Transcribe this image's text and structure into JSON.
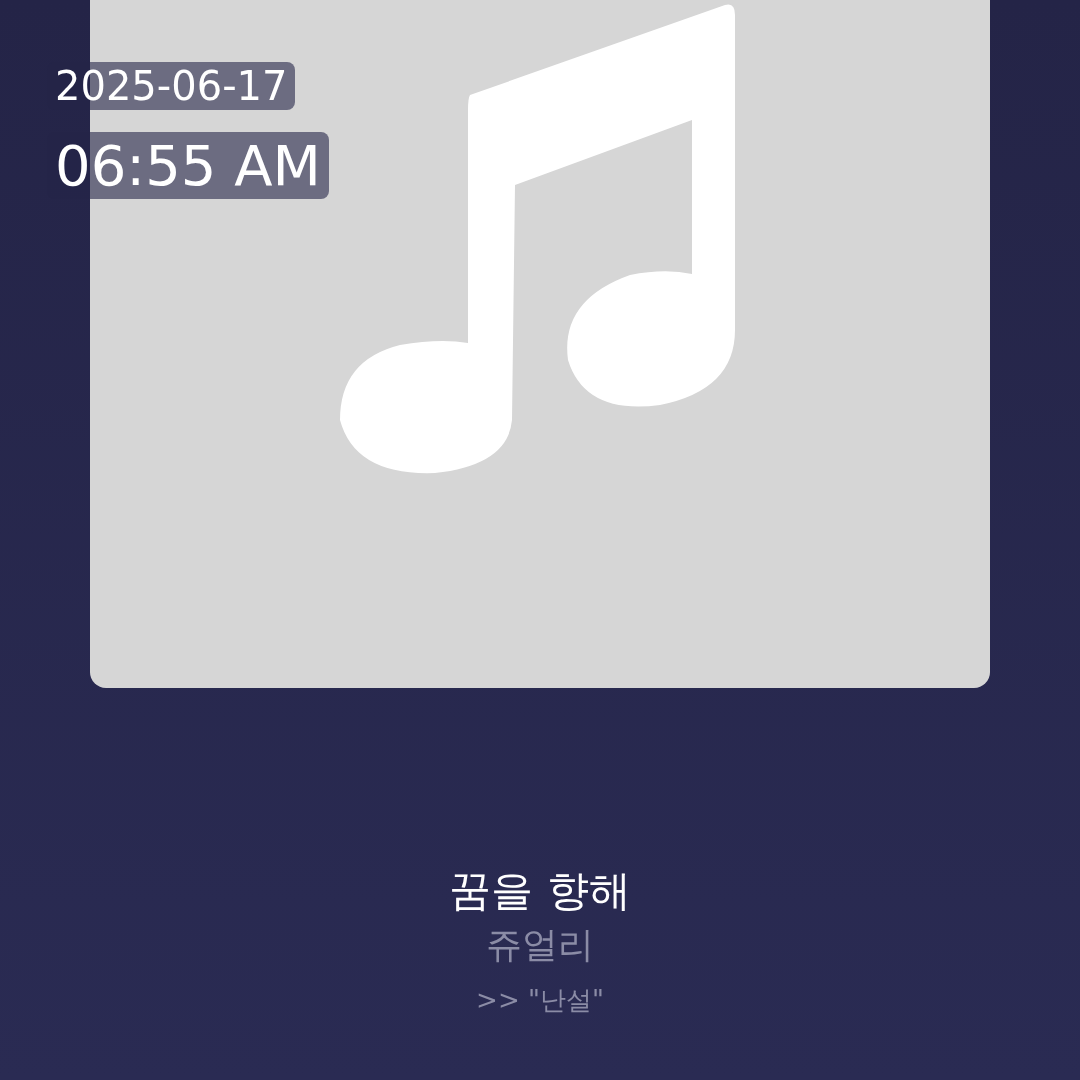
{
  "clock": {
    "date": "2025-06-17",
    "time": "06:55 AM"
  },
  "track": {
    "title": "꿈을 향해",
    "artist": "쥬얼리",
    "lyric": ">> \"난설\""
  }
}
